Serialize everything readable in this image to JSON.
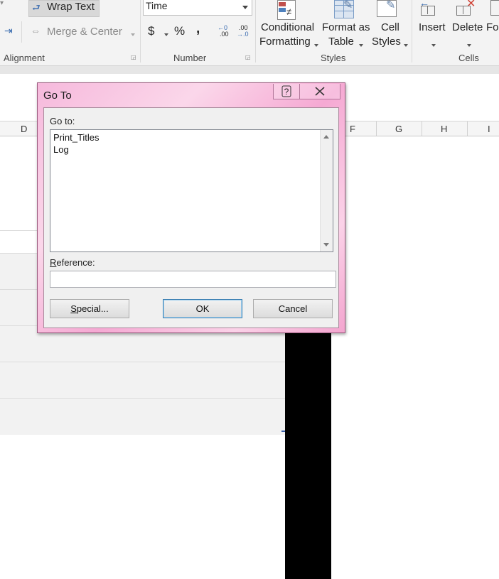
{
  "ribbon": {
    "wrap_text": "Wrap Text",
    "merge_center": "Merge & Center",
    "alignment_label": "Alignment",
    "number_format": "Time",
    "currency": "$",
    "percent": "%",
    "comma": ",",
    "increase_decimal": ".00",
    "decrease_decimal": ".00",
    "number_label": "Number",
    "cond_fmt_l1": "Conditional",
    "cond_fmt_l2": "Formatting",
    "format_table_l1": "Format as",
    "format_table_l2": "Table",
    "cell_styles_l1": "Cell",
    "cell_styles_l2": "Styles",
    "styles_label": "Styles",
    "insert": "Insert",
    "delete": "Delete",
    "format_partial": "Fo",
    "cells_label": "Cells"
  },
  "sheet": {
    "columns": [
      "D",
      "F",
      "G",
      "H",
      "I"
    ]
  },
  "dialog": {
    "title": "Go To",
    "help_glyph": "?",
    "close_glyph": "X",
    "goto_label": "Go to:",
    "items": [
      "Print_Titles",
      "Log"
    ],
    "reference_label_u": "R",
    "reference_label_rest": "eference:",
    "reference_value": "",
    "special_u": "S",
    "special_rest": "pecial...",
    "ok": "OK",
    "cancel": "Cancel"
  },
  "colors": {
    "dialog_frame": "#f6b9dc",
    "ribbon_bg": "#f3f3f3"
  }
}
